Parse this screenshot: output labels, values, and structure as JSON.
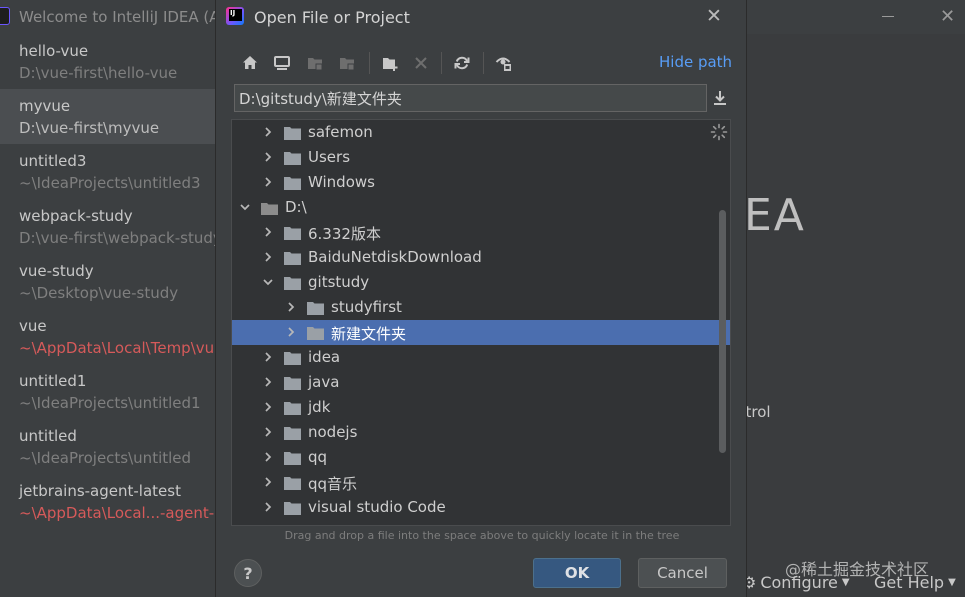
{
  "welcome": {
    "title": "Welcome to IntelliJ IDEA (A",
    "logo_text": "EA",
    "action_text": "ntrol",
    "configure_label": "Configure",
    "gethelp_label": "Get Help",
    "watermark": "@稀土掘金技术社区",
    "recent_projects": [
      {
        "name": "hello-vue",
        "path": "D:\\vue-first\\hello-vue",
        "missing": false,
        "selected": false
      },
      {
        "name": "myvue",
        "path": "D:\\vue-first\\myvue",
        "missing": false,
        "selected": true
      },
      {
        "name": "untitled3",
        "path": "~\\IdeaProjects\\untitled3",
        "missing": false,
        "selected": false
      },
      {
        "name": "webpack-study",
        "path": "D:\\vue-first\\webpack-study",
        "missing": false,
        "selected": false
      },
      {
        "name": "vue-study",
        "path": "~\\Desktop\\vue-study",
        "missing": false,
        "selected": false
      },
      {
        "name": "vue",
        "path": "~\\AppData\\Local\\Temp\\vu",
        "missing": true,
        "selected": false
      },
      {
        "name": "untitled1",
        "path": "~\\IdeaProjects\\untitled1",
        "missing": false,
        "selected": false
      },
      {
        "name": "untitled",
        "path": "~\\IdeaProjects\\untitled",
        "missing": false,
        "selected": false
      },
      {
        "name": "jetbrains-agent-latest",
        "path": "~\\AppData\\Local...-agent-l",
        "missing": true,
        "selected": false
      }
    ]
  },
  "dialog": {
    "title": "Open File or Project",
    "hide_path_label": "Hide path",
    "path_value": "D:\\gitstudy\\新建文件夹",
    "drop_hint": "Drag and drop a file into the space above to quickly locate it in the tree",
    "ok_label": "OK",
    "cancel_label": "Cancel",
    "help_label": "?",
    "toolbar": [
      "home-icon",
      "desktop-icon",
      "project-folder-icon",
      "module-folder-icon",
      "new-folder-icon",
      "delete-icon",
      "refresh-icon",
      "show-hidden-icon"
    ],
    "tree": [
      {
        "label": "safemon",
        "depth": 1,
        "expanded": false,
        "selected": false,
        "drive": false
      },
      {
        "label": "Users",
        "depth": 1,
        "expanded": false,
        "selected": false,
        "drive": false
      },
      {
        "label": "Windows",
        "depth": 1,
        "expanded": false,
        "selected": false,
        "drive": false
      },
      {
        "label": "D:\\",
        "depth": 0,
        "expanded": true,
        "selected": false,
        "drive": true
      },
      {
        "label": "6.332版本",
        "depth": 1,
        "expanded": false,
        "selected": false,
        "drive": false
      },
      {
        "label": "BaiduNetdiskDownload",
        "depth": 1,
        "expanded": false,
        "selected": false,
        "drive": false
      },
      {
        "label": "gitstudy",
        "depth": 1,
        "expanded": true,
        "selected": false,
        "drive": false
      },
      {
        "label": "studyfirst",
        "depth": 2,
        "expanded": false,
        "selected": false,
        "drive": false
      },
      {
        "label": "新建文件夹",
        "depth": 2,
        "expanded": false,
        "selected": true,
        "drive": false
      },
      {
        "label": "idea",
        "depth": 1,
        "expanded": false,
        "selected": false,
        "drive": false
      },
      {
        "label": "java",
        "depth": 1,
        "expanded": false,
        "selected": false,
        "drive": false
      },
      {
        "label": "jdk",
        "depth": 1,
        "expanded": false,
        "selected": false,
        "drive": false
      },
      {
        "label": "nodejs",
        "depth": 1,
        "expanded": false,
        "selected": false,
        "drive": false
      },
      {
        "label": "qq",
        "depth": 1,
        "expanded": false,
        "selected": false,
        "drive": false
      },
      {
        "label": "qq音乐",
        "depth": 1,
        "expanded": false,
        "selected": false,
        "drive": false
      },
      {
        "label": "visual studio Code",
        "depth": 1,
        "expanded": false,
        "selected": false,
        "drive": false
      }
    ]
  }
}
